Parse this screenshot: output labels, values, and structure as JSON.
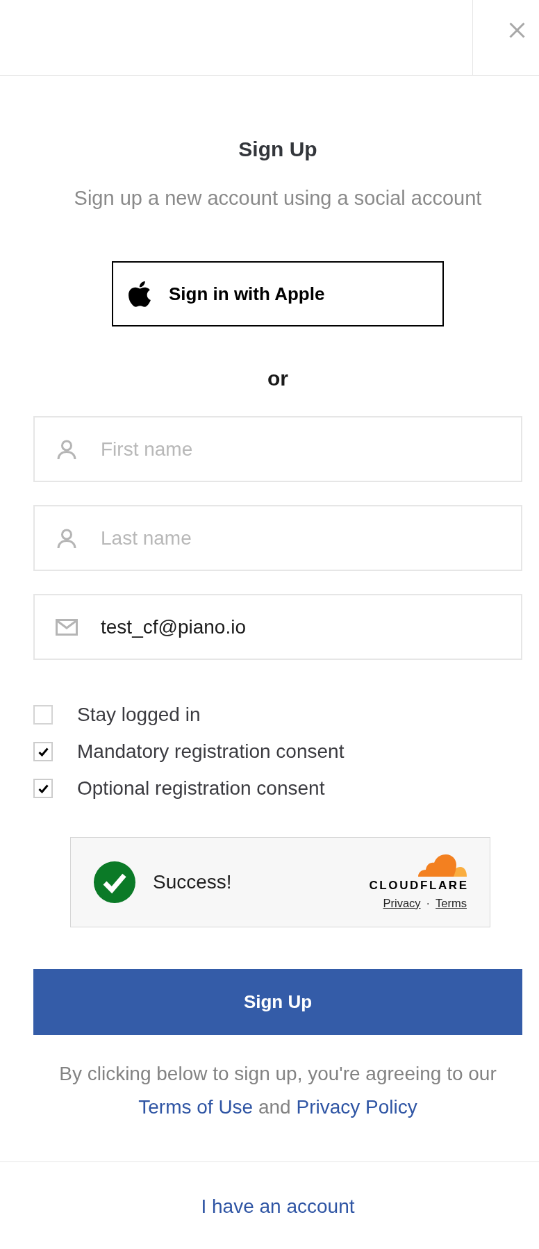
{
  "title": "Sign Up",
  "subtitle": "Sign up a new account using a social account",
  "social_buttons": [
    {
      "kind": "apple",
      "label": "Sign in with Apple"
    }
  ],
  "separator_text": "or",
  "fields": [
    {
      "kind": "person",
      "placeholder": "First name"
    },
    {
      "kind": "person",
      "placeholder": "Last name"
    },
    {
      "kind": "email",
      "value": "test_cf@piano.io"
    }
  ],
  "checkboxes": [
    {
      "label": "Stay logged in",
      "checked": false
    },
    {
      "label": "Mandatory registration consent",
      "checked": true
    },
    {
      "label": "Optional registration consent",
      "checked": true
    }
  ],
  "captcha": {
    "status": "Success!",
    "brand": "CLOUDFLARE",
    "links": [
      "Privacy",
      "Terms"
    ],
    "link_separator": "·"
  },
  "submit_button": "Sign Up",
  "agreement": [
    {
      "kind": "text",
      "text": "By clicking below to sign up, you're agreeing to our"
    },
    {
      "kind": "link",
      "text": "Terms of Use"
    },
    {
      "kind": "text",
      "text": "and"
    },
    {
      "kind": "link",
      "text": "Privacy Policy"
    }
  ],
  "login_link": "I have an account"
}
